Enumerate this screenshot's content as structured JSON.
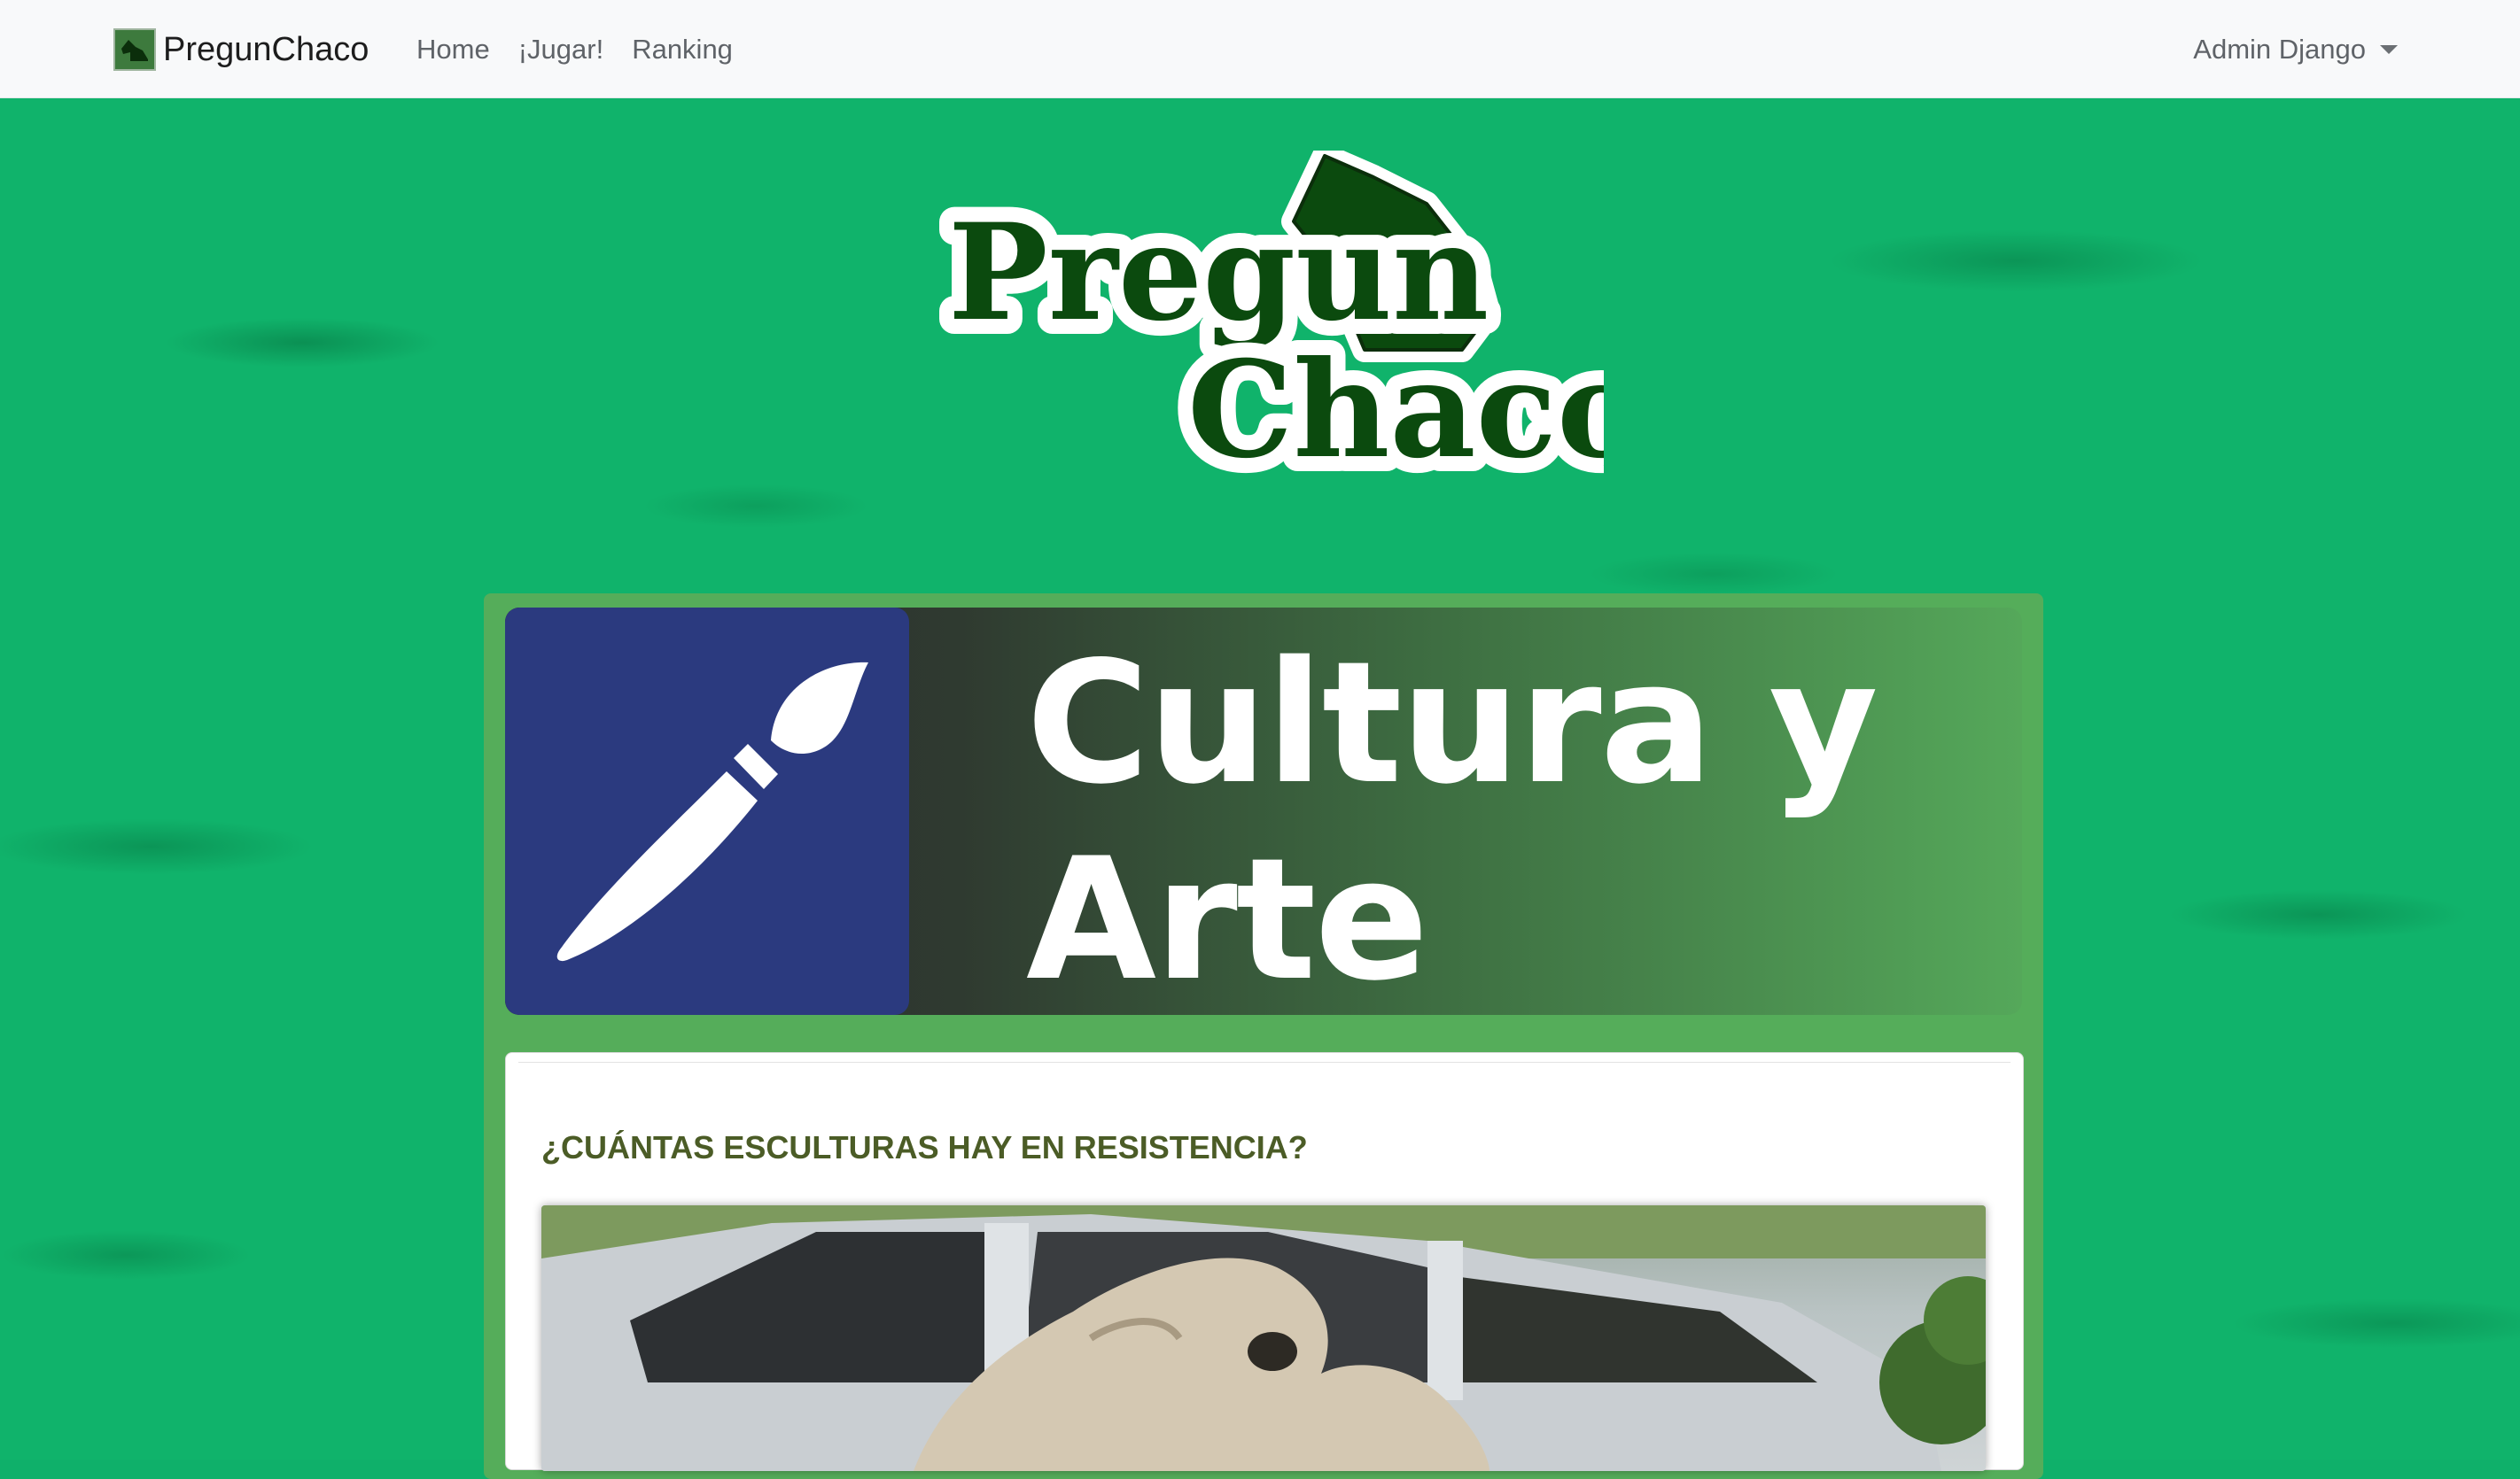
{
  "navbar": {
    "brand": "PregunChaco",
    "links": [
      "Home",
      "¡Jugar!",
      "Ranking"
    ],
    "user": "Admin Django"
  },
  "logo": {
    "line1": "Pregun",
    "line2": "Chaco"
  },
  "category": {
    "title": "Cultura y Arte",
    "icon": "paintbrush-icon",
    "colors": {
      "icon_bg": "#2b3a7f",
      "card_bg": "#55ad5a"
    }
  },
  "question": {
    "text": "¿CUÁNTAS ESCULTURAS HAY EN RESISTENCIA?",
    "image": "sculpture-photo"
  },
  "colors": {
    "background": "#10b36b",
    "logo_green": "#0b4a0e",
    "question_text": "#4b5c26"
  }
}
